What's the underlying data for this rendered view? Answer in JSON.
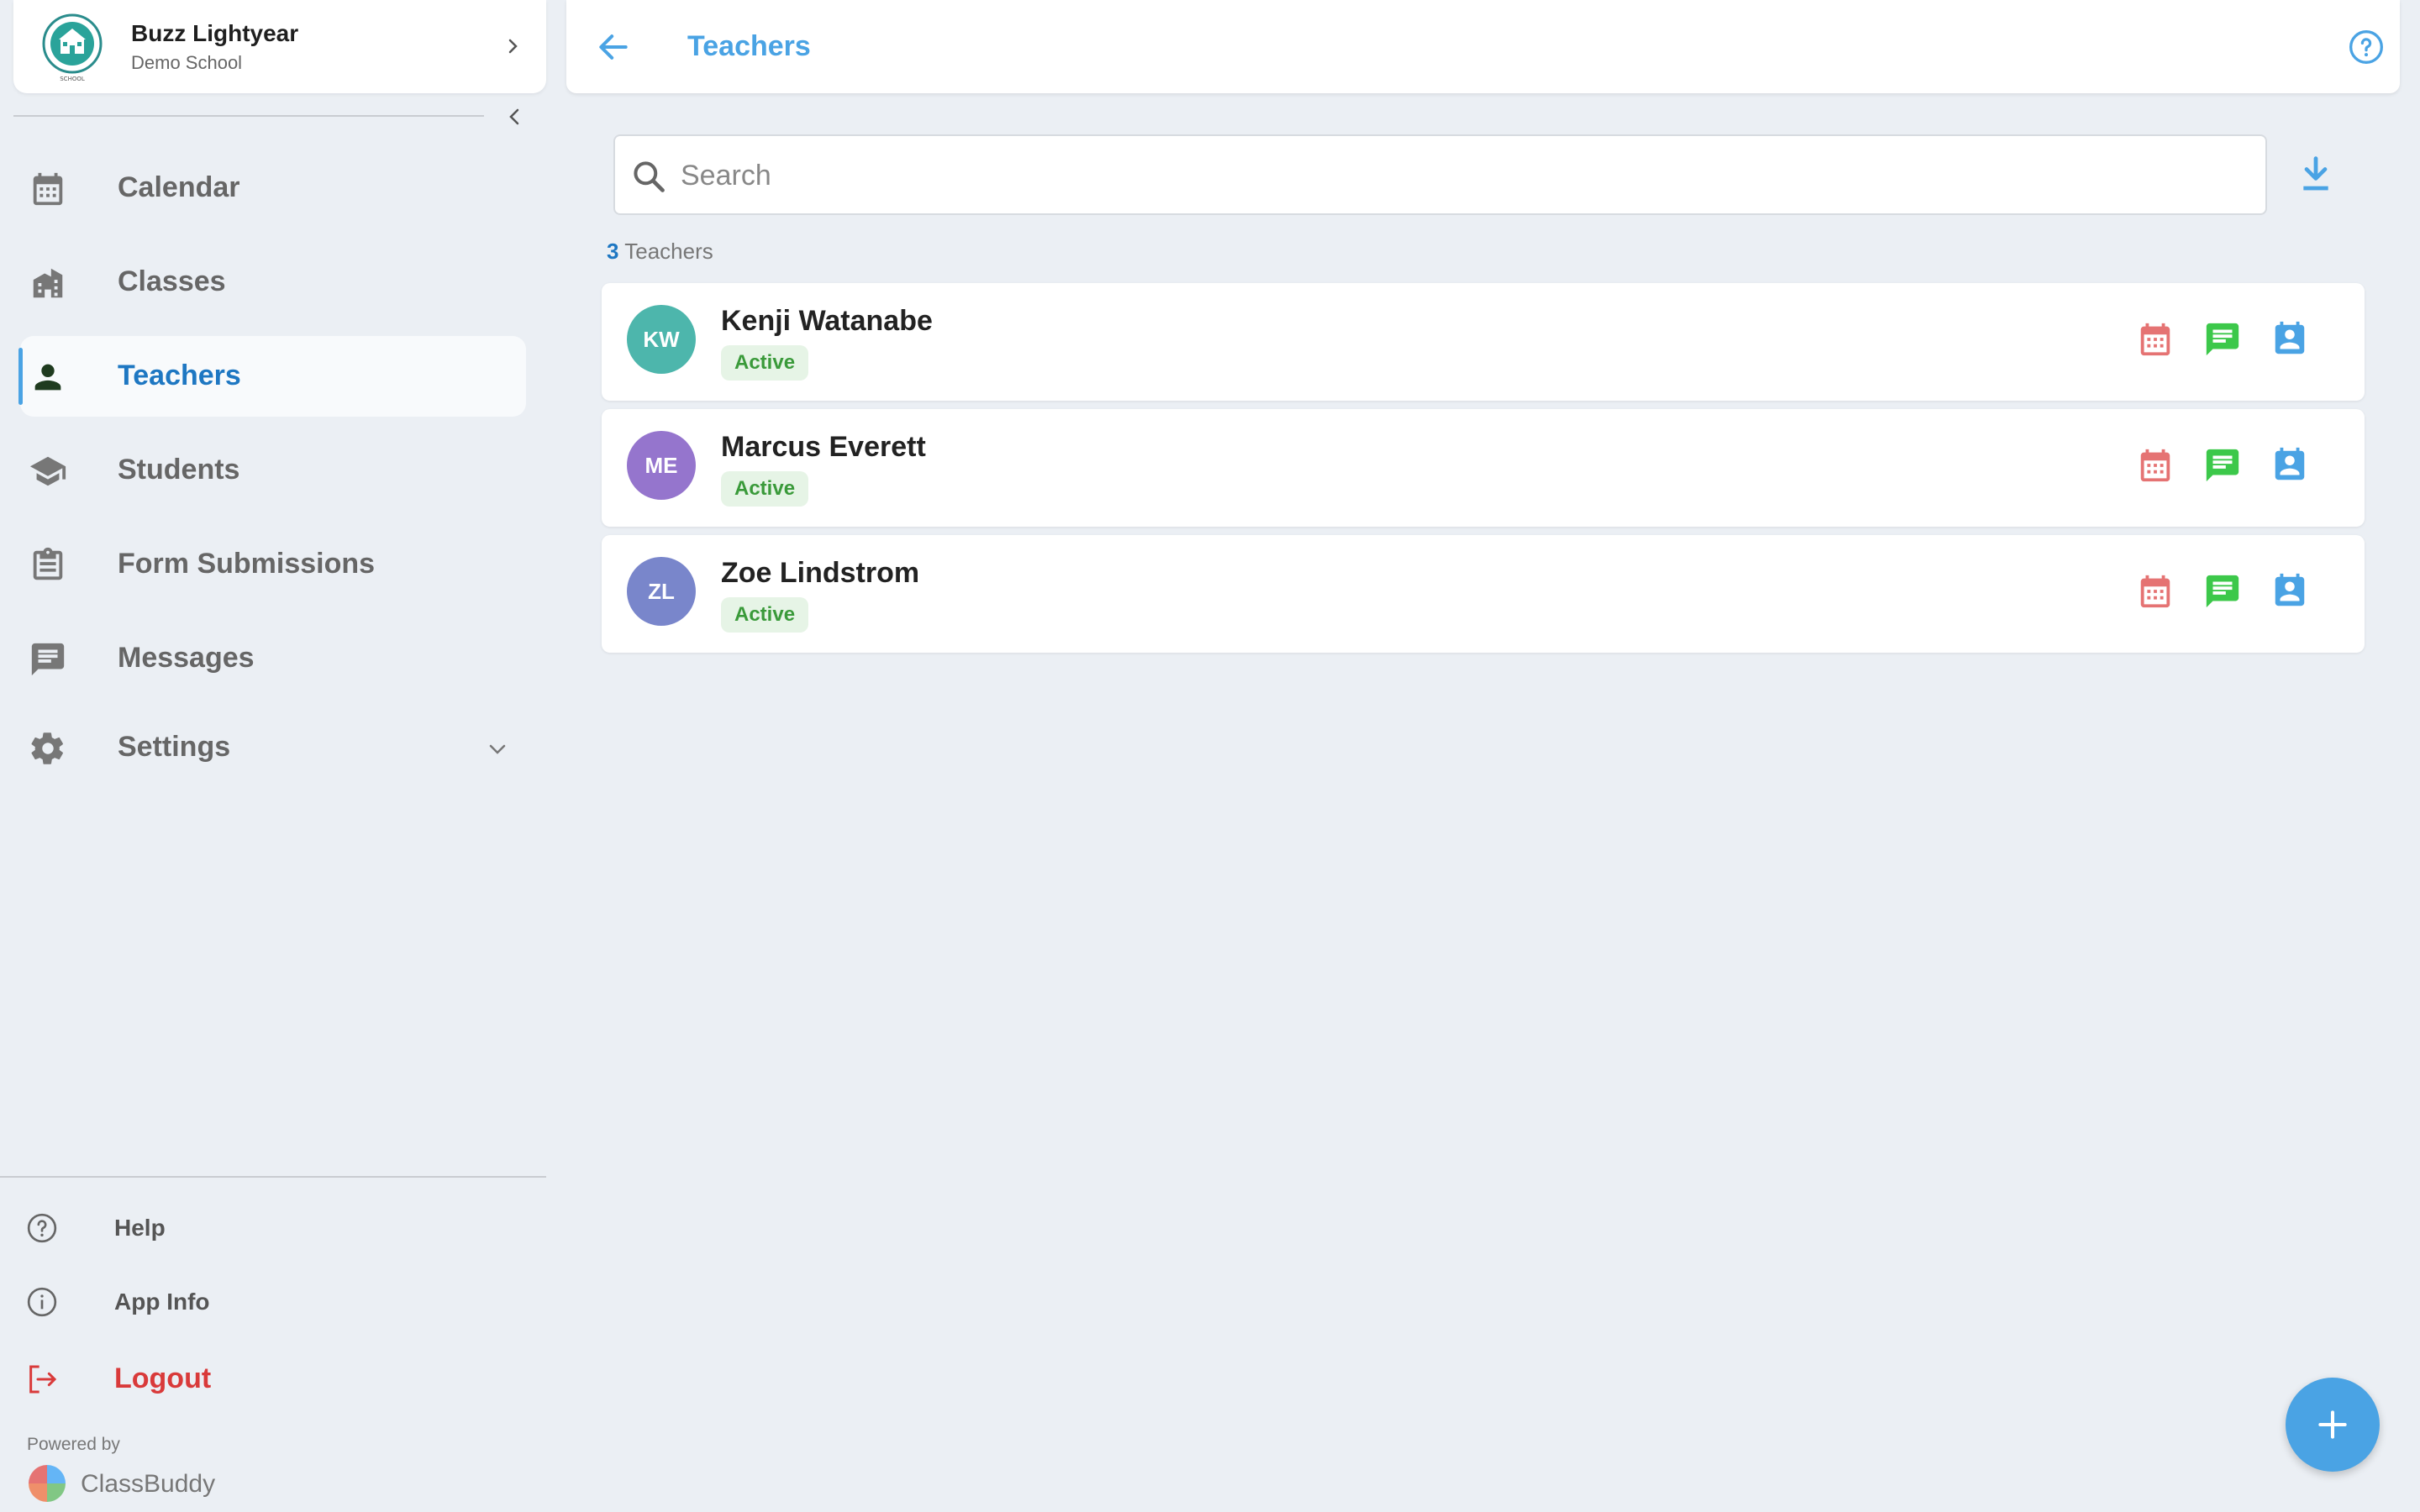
{
  "profile": {
    "name": "Buzz Lightyear",
    "school": "Demo School",
    "logo_text": "SCHOOL"
  },
  "nav": {
    "calendar": "Calendar",
    "classes": "Classes",
    "teachers": "Teachers",
    "students": "Students",
    "forms": "Form Submissions",
    "messages": "Messages",
    "settings": "Settings"
  },
  "bottom": {
    "help": "Help",
    "app_info": "App Info",
    "logout": "Logout",
    "powered_by": "Powered by",
    "brand": "ClassBuddy"
  },
  "header": {
    "title": "Teachers"
  },
  "search": {
    "placeholder": "Search",
    "value": ""
  },
  "summary": {
    "count": "3",
    "label": "Teachers"
  },
  "teachers": [
    {
      "initials": "KW",
      "name": "Kenji Watanabe",
      "status": "Active",
      "color": "#4db6ac"
    },
    {
      "initials": "ME",
      "name": "Marcus Everett",
      "status": "Active",
      "color": "#9575cd"
    },
    {
      "initials": "ZL",
      "name": "Zoe Lindstrom",
      "status": "Active",
      "color": "#7986cb"
    }
  ],
  "colors": {
    "accent": "#4aa3e4",
    "active_nav": "#1e77c2",
    "calendar_icon": "#e57373",
    "message_icon": "#3cc84a",
    "profile_icon": "#4aa3e4",
    "logout": "#d93a3a",
    "status_green": "#3a9a3a"
  },
  "icons": {
    "calendar": "calendar-icon",
    "classes": "school-building-icon",
    "teachers": "person-icon",
    "students": "graduation-cap-icon",
    "forms": "clipboard-icon",
    "messages": "chat-icon",
    "settings": "gear-icon",
    "help": "help-circle-icon",
    "app_info": "info-icon",
    "logout": "logout-icon",
    "download": "download-icon",
    "add": "plus-icon"
  }
}
